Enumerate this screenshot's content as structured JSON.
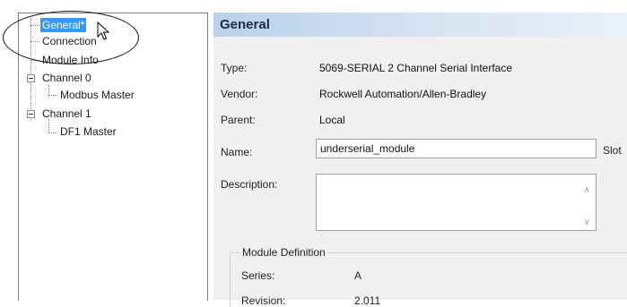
{
  "tree": {
    "items": [
      {
        "label": "General*"
      },
      {
        "label": "Connection"
      },
      {
        "label": "Module Info"
      },
      {
        "label": "Channel 0"
      },
      {
        "label": "Modbus Master"
      },
      {
        "label": "Channel 1"
      },
      {
        "label": "DF1 Master"
      }
    ]
  },
  "header": {
    "title": "General"
  },
  "fields": {
    "type_label": "Type:",
    "type_value": "5069-SERIAL 2 Channel Serial Interface",
    "vendor_label": "Vendor:",
    "vendor_value": "Rockwell Automation/Allen-Bradley",
    "parent_label": "Parent:",
    "parent_value": "Local",
    "name_label": "Name:",
    "name_value": "underserial_module",
    "slot_label": "Slot",
    "description_label": "Description:",
    "description_value": ""
  },
  "module_definition": {
    "legend": "Module Definition",
    "series_label": "Series:",
    "series_value": "A",
    "revision_label": "Revision:",
    "revision_value": "2.011"
  },
  "colors": {
    "selection": "#3399ff",
    "header_start": "#b9d1ea",
    "panel_bg": "#f0f0f0"
  }
}
